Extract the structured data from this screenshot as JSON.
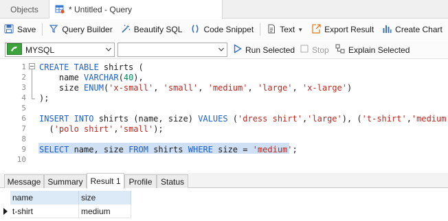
{
  "tabs": {
    "objects_label": "Objects",
    "query_label": "* Untitled - Query"
  },
  "toolbar": {
    "save_label": "Save",
    "query_builder_label": "Query Builder",
    "beautify_label": "Beautify SQL",
    "snippet_label": "Code Snippet",
    "text_label": "Text",
    "export_label": "Export Result",
    "chart_label": "Create Chart"
  },
  "connection": {
    "connection_value": "MYSQL",
    "database_value": "",
    "run_selected_label": "Run Selected",
    "stop_label": "Stop",
    "explain_label": "Explain Selected"
  },
  "editor": {
    "line_numbers": [
      "1",
      "2",
      "3",
      "4",
      "5",
      "6",
      "7",
      "8",
      "9",
      "10"
    ],
    "lines": [
      [
        {
          "t": "CREATE TABLE ",
          "c": "kw"
        },
        {
          "t": "shirts (",
          "c": ""
        }
      ],
      [
        {
          "t": "    name ",
          "c": ""
        },
        {
          "t": "VARCHAR",
          "c": "kw"
        },
        {
          "t": "(",
          "c": ""
        },
        {
          "t": "40",
          "c": "num"
        },
        {
          "t": "),",
          "c": ""
        }
      ],
      [
        {
          "t": "    size ",
          "c": ""
        },
        {
          "t": "ENUM",
          "c": "kw"
        },
        {
          "t": "(",
          "c": ""
        },
        {
          "t": "'x-small'",
          "c": "str"
        },
        {
          "t": ", ",
          "c": ""
        },
        {
          "t": "'small'",
          "c": "str"
        },
        {
          "t": ", ",
          "c": ""
        },
        {
          "t": "'medium'",
          "c": "str"
        },
        {
          "t": ", ",
          "c": ""
        },
        {
          "t": "'large'",
          "c": "str"
        },
        {
          "t": ", ",
          "c": ""
        },
        {
          "t": "'x-large'",
          "c": "str"
        },
        {
          "t": ")",
          "c": ""
        }
      ],
      [
        {
          "t": ");",
          "c": ""
        }
      ],
      [],
      [
        {
          "t": "INSERT INTO ",
          "c": "kw"
        },
        {
          "t": "shirts (name, size) ",
          "c": ""
        },
        {
          "t": "VALUES ",
          "c": "kw"
        },
        {
          "t": "(",
          "c": ""
        },
        {
          "t": "'dress shirt'",
          "c": "str"
        },
        {
          "t": ",",
          "c": ""
        },
        {
          "t": "'large'",
          "c": "str"
        },
        {
          "t": "), (",
          "c": ""
        },
        {
          "t": "'t-shirt'",
          "c": "str"
        },
        {
          "t": ",",
          "c": ""
        },
        {
          "t": "'medium'",
          "c": "str"
        },
        {
          "t": "),",
          "c": ""
        }
      ],
      [
        {
          "t": "  (",
          "c": ""
        },
        {
          "t": "'polo shirt'",
          "c": "str"
        },
        {
          "t": ",",
          "c": ""
        },
        {
          "t": "'small'",
          "c": "str"
        },
        {
          "t": ");",
          "c": ""
        }
      ],
      [],
      [
        {
          "t": "SELECT ",
          "c": "kw"
        },
        {
          "t": "name, size ",
          "c": ""
        },
        {
          "t": "FROM ",
          "c": "kw"
        },
        {
          "t": "shirts ",
          "c": ""
        },
        {
          "t": "WHERE ",
          "c": "kw"
        },
        {
          "t": "size = ",
          "c": ""
        },
        {
          "t": "'medium'",
          "c": "str"
        },
        {
          "t": ";",
          "c": ""
        }
      ],
      []
    ]
  },
  "result_tabs": [
    "Message",
    "Summary",
    "Result 1",
    "Profile",
    "Status"
  ],
  "active_result_tab": "Result 1",
  "grid": {
    "columns": [
      "name",
      "size"
    ],
    "rows": [
      [
        "t-shirt",
        "medium"
      ]
    ]
  },
  "colors": {
    "keyword": "#1c5fc5",
    "string": "#b5271f",
    "number": "#098658",
    "selection": "#cfe0f4",
    "grid_header": "#dce9f7"
  }
}
